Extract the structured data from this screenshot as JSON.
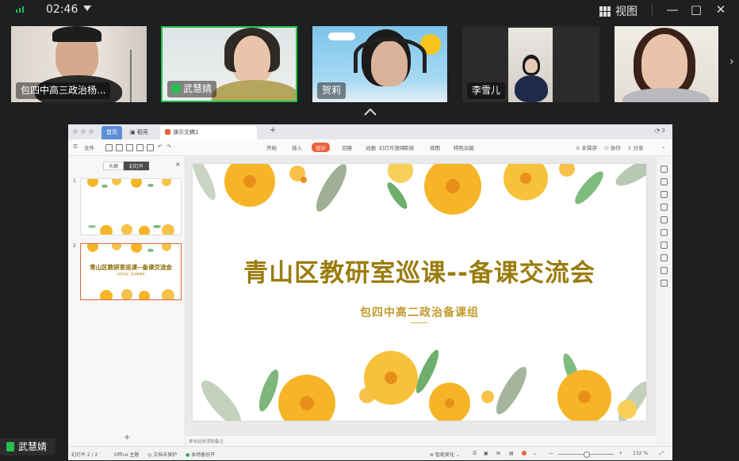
{
  "topbar": {
    "time": "02:46",
    "view_label": "视图",
    "controls": [
      "—",
      "□",
      "✕"
    ]
  },
  "participants": [
    {
      "name": "包四中高三政治杨...",
      "speaking": false
    },
    {
      "name": "武慧婧",
      "speaking": true
    },
    {
      "name": "贺莉",
      "speaking": false
    },
    {
      "name": "李雪儿",
      "speaking": false
    },
    {
      "name": "",
      "speaking": false
    }
  ],
  "window": {
    "tabs": {
      "home": "首页",
      "docs": "稻壳",
      "active": "演示文稿1"
    },
    "ribbon": {
      "file": "文件",
      "menus": [
        "开始",
        "插入",
        "设计",
        "切换",
        "动画",
        "幻灯片放映",
        "审阅",
        "视图",
        "特色功能"
      ],
      "selected_menu": "设计",
      "right": [
        "未保存",
        "协作",
        "分享"
      ]
    },
    "left_panel": {
      "seg_outline": "大纲",
      "seg_slides": "幻灯片",
      "thumb1_num": "1",
      "thumb2_num": "2",
      "thumb2_title": "青山区教研室巡课--备课交流会",
      "thumb2_sub": "包四中高二政治备课组"
    },
    "slide": {
      "title": "青山区教研室巡课--备课交流会",
      "subtitle": "包四中高二政治备课组"
    },
    "notes_placeholder": "单击此处添加备注",
    "status": {
      "slide_counter": "幻灯片 2 / 2",
      "theme": "Office 主题",
      "auto_backup": "文档未保护",
      "cloud": "本地备份开",
      "beautify": "智能美化",
      "zoom": "132 %"
    },
    "colors": {
      "accent": "#e9633b",
      "title_gold": "#9a7c0e",
      "flower": "#f6b526"
    }
  },
  "speaker_tag": {
    "name": "武慧婧"
  }
}
